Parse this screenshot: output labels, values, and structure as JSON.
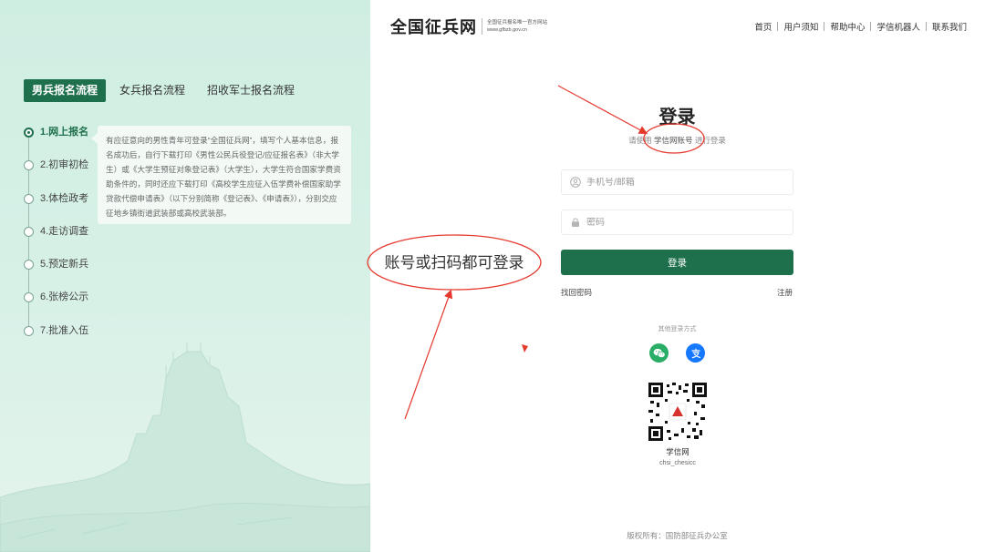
{
  "header": {
    "logo_main": "全国征兵网",
    "logo_sub_line1": "全国征兵报名唯一官方网站",
    "logo_sub_line2": "www.gfbzb.gov.cn",
    "nav": [
      "首页",
      "用户须知",
      "帮助中心",
      "学信机器人",
      "联系我们"
    ]
  },
  "sidebar": {
    "tabs": [
      "男兵报名流程",
      "女兵报名流程",
      "招收军士报名流程"
    ],
    "active_tab": 0,
    "steps": [
      "1.网上报名",
      "2.初审初检",
      "3.体检政考",
      "4.走访调查",
      "5.预定新兵",
      "6.张榜公示",
      "7.批准入伍"
    ],
    "active_step": 0,
    "step_description": "有应征意向的男性青年可登录“全国征兵网”，填写个人基本信息，报名成功后，自行下载打印《男性公民兵役登记/应征报名表》（非大学生）或《大学生预征对象登记表》（大学生），大学生符合国家学费资助条件的，同时还应下载打印《高校学生应征入伍学费补偿国家助学贷款代偿申请表》（以下分别简称《登记表》、《申请表》），分别交应征地乡镇街道武装部或高校武装部。"
  },
  "login": {
    "title": "登录",
    "subtitle_prefix": "请使用",
    "subtitle_highlight": "学信网账号",
    "subtitle_suffix": "进行登录",
    "username_placeholder": "手机号/邮箱",
    "password_placeholder": "密码",
    "submit_label": "登录",
    "forgot_label": "找回密码",
    "register_label": "注册",
    "other_methods_label": "其他登录方式",
    "qr_name": "学信网",
    "qr_id": "chsi_chesicc"
  },
  "footer": {
    "copyright": "版权所有：国防部征兵办公室"
  },
  "annotation": {
    "text": "账号或扫码都可登录"
  },
  "colors": {
    "brand_green": "#1e6f4c",
    "panel_bg": "#d2efe3",
    "wechat_green": "#2aae67",
    "alipay_blue": "#1677ff",
    "annotation_red": "#e5392e"
  },
  "icons": [
    "user-icon",
    "lock-icon",
    "wechat-icon",
    "alipay-icon"
  ]
}
